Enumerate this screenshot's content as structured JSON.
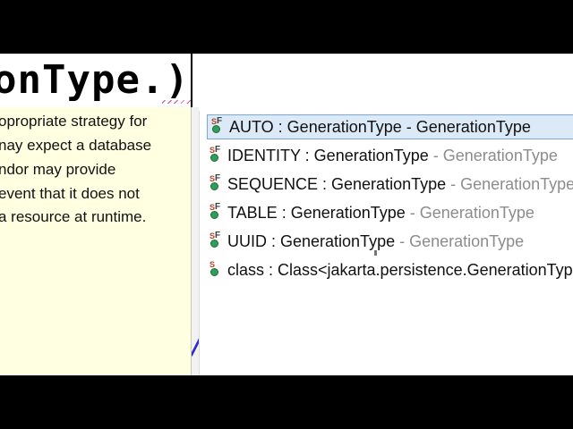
{
  "editor": {
    "code_text": "onType.)"
  },
  "javadoc": {
    "lines": [
      "opropriate strategy for",
      "nay expect a database",
      "ndor may provide",
      "event that it does not",
      "a resource at runtime."
    ]
  },
  "proposals": {
    "items": [
      {
        "name": "AUTO : GenerationType",
        "sep": " - ",
        "owner": "GenerationType",
        "icon": "static-final-field-icon",
        "selected": true
      },
      {
        "name": "IDENTITY : GenerationType",
        "sep": " - ",
        "owner": "GenerationType",
        "icon": "static-final-field-icon",
        "selected": false
      },
      {
        "name": "SEQUENCE : GenerationType",
        "sep": " - ",
        "owner": "GenerationType",
        "icon": "static-final-field-icon",
        "selected": false
      },
      {
        "name": "TABLE : GenerationType",
        "sep": " - ",
        "owner": "GenerationType",
        "icon": "static-final-field-icon",
        "selected": false
      },
      {
        "name": "UUID : GenerationType",
        "sep": " - ",
        "owner": "GenerationType",
        "icon": "static-final-field-icon",
        "selected": false
      },
      {
        "name": "class : Class<jakarta.persistence.GenerationType>",
        "sep": "",
        "owner": "",
        "icon": "static-field-icon",
        "selected": false
      }
    ]
  },
  "colors": {
    "javadoc_bg": "#ffffe1",
    "selection_bg": "#dceaf8",
    "selection_border": "#7aa7d6",
    "secondary_text": "#8c8c8c"
  }
}
